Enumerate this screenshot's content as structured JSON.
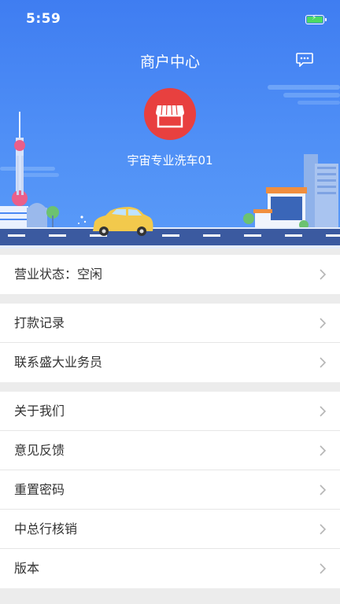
{
  "status_bar": {
    "time": "5:59"
  },
  "header": {
    "title": "商户中心",
    "shop_name": "宇宙专业洗车01",
    "message_icon": "chat-bubble-icon",
    "shop_icon": "storefront-icon"
  },
  "colors": {
    "header_blue": "#4a88f4",
    "avatar_red": "#e8403f",
    "road": "#3b5aa0",
    "battery_green": "#4cd964"
  },
  "menu": {
    "group1": [
      {
        "label": "营业状态：空闲"
      }
    ],
    "group2": [
      {
        "label": "打款记录"
      },
      {
        "label": "联系盛大业务员"
      }
    ],
    "group3": [
      {
        "label": "关于我们"
      },
      {
        "label": "意见反馈"
      },
      {
        "label": "重置密码"
      },
      {
        "label": "中总行核销"
      },
      {
        "label": "版本"
      }
    ]
  }
}
